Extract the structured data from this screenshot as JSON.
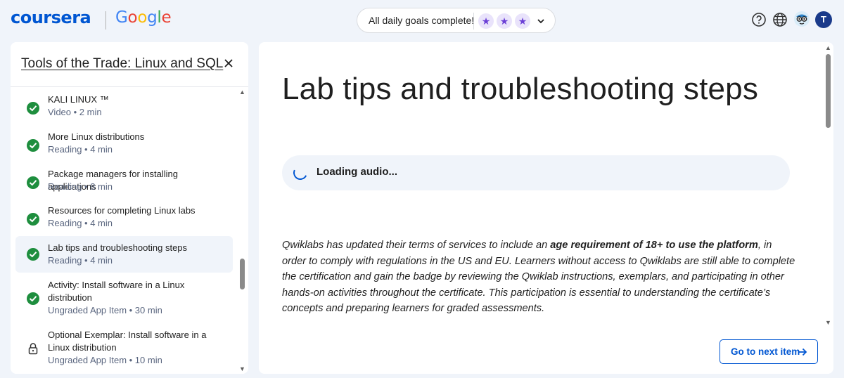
{
  "header": {
    "brand": "coursera",
    "partner": [
      "G",
      "o",
      "o",
      "g",
      "l",
      "e"
    ],
    "goals_text": "All daily goals complete!",
    "goal_stars": [
      "star-icon",
      "star-icon",
      "star-icon"
    ],
    "avatar_initial": "T",
    "icons": [
      "help-icon",
      "globe-icon",
      "accessibility-icon"
    ]
  },
  "sidebar": {
    "course_title": "Tools of the Trade: Linux and SQL",
    "items": [
      {
        "title": "KALI LINUX ™",
        "meta": "Video • 2 min",
        "status": "complete"
      },
      {
        "title": "More Linux distributions",
        "meta": "Reading • 4 min",
        "status": "complete"
      },
      {
        "title": "Package managers for installing applications",
        "meta": "Reading • 8 min",
        "status": "complete"
      },
      {
        "title": "Resources for completing Linux labs",
        "meta": "Reading • 4 min",
        "status": "complete"
      },
      {
        "title": "Lab tips and troubleshooting steps",
        "meta": "Reading • 4 min",
        "status": "complete",
        "active": true
      },
      {
        "title": "Activity: Install software in a Linux distribution",
        "meta": "Ungraded App Item • 30 min",
        "status": "complete"
      },
      {
        "title": "Optional Exemplar: Install software in a Linux distribution",
        "meta": "Ungraded App Item • 10 min",
        "status": "locked"
      }
    ]
  },
  "main": {
    "title": "Lab tips and troubleshooting steps",
    "audio_status": "Loading audio...",
    "paragraph": {
      "lead": "Qwiklabs  has updated their terms of services to include an ",
      "bold": "age requirement of 18+ to use the platform",
      "tail": ", in order to comply with regulations in the US and EU. Learners without access to Qwiklabs are still able to complete the certification and gain the badge by reviewing the Qwiklab instructions, exemplars, and participating in other hands-on activities throughout the certificate. This participation is essential to understanding the certificate’s concepts and preparing learners for graded assessments."
    },
    "next_button": "Go to next item"
  },
  "colors": {
    "brand_blue": "#0056d2",
    "complete_green": "#1e8e3e",
    "star_purple": "#6b3fd6",
    "active_bg": "#f0f4fa"
  }
}
